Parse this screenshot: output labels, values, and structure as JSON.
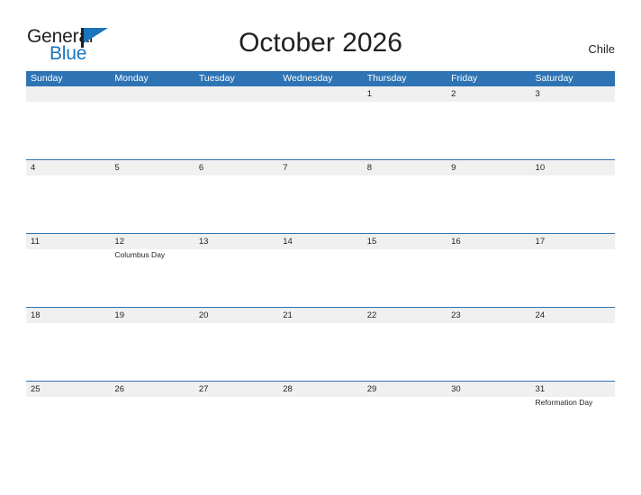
{
  "brand": {
    "name_part1": "General",
    "name_part2": "Blue",
    "flag_icon": "flag-icon",
    "accent_color": "#1a75bc"
  },
  "header": {
    "title": "October 2026",
    "region": "Chile"
  },
  "colors": {
    "header_blue": "#2E74B5",
    "daynum_band_gray": "#F0F0F0",
    "text": "#231f20"
  },
  "calendar": {
    "weekdays": [
      "Sunday",
      "Monday",
      "Tuesday",
      "Wednesday",
      "Thursday",
      "Friday",
      "Saturday"
    ],
    "weeks": [
      {
        "days": [
          {
            "num": "",
            "events": []
          },
          {
            "num": "",
            "events": []
          },
          {
            "num": "",
            "events": []
          },
          {
            "num": "",
            "events": []
          },
          {
            "num": "1",
            "events": []
          },
          {
            "num": "2",
            "events": []
          },
          {
            "num": "3",
            "events": []
          }
        ]
      },
      {
        "days": [
          {
            "num": "4",
            "events": []
          },
          {
            "num": "5",
            "events": []
          },
          {
            "num": "6",
            "events": []
          },
          {
            "num": "7",
            "events": []
          },
          {
            "num": "8",
            "events": []
          },
          {
            "num": "9",
            "events": []
          },
          {
            "num": "10",
            "events": []
          }
        ]
      },
      {
        "days": [
          {
            "num": "11",
            "events": []
          },
          {
            "num": "12",
            "events": [
              "Columbus Day"
            ]
          },
          {
            "num": "13",
            "events": []
          },
          {
            "num": "14",
            "events": []
          },
          {
            "num": "15",
            "events": []
          },
          {
            "num": "16",
            "events": []
          },
          {
            "num": "17",
            "events": []
          }
        ]
      },
      {
        "days": [
          {
            "num": "18",
            "events": []
          },
          {
            "num": "19",
            "events": []
          },
          {
            "num": "20",
            "events": []
          },
          {
            "num": "21",
            "events": []
          },
          {
            "num": "22",
            "events": []
          },
          {
            "num": "23",
            "events": []
          },
          {
            "num": "24",
            "events": []
          }
        ]
      },
      {
        "days": [
          {
            "num": "25",
            "events": []
          },
          {
            "num": "26",
            "events": []
          },
          {
            "num": "27",
            "events": []
          },
          {
            "num": "28",
            "events": []
          },
          {
            "num": "29",
            "events": []
          },
          {
            "num": "30",
            "events": []
          },
          {
            "num": "31",
            "events": [
              "Reformation Day"
            ]
          }
        ]
      }
    ]
  }
}
